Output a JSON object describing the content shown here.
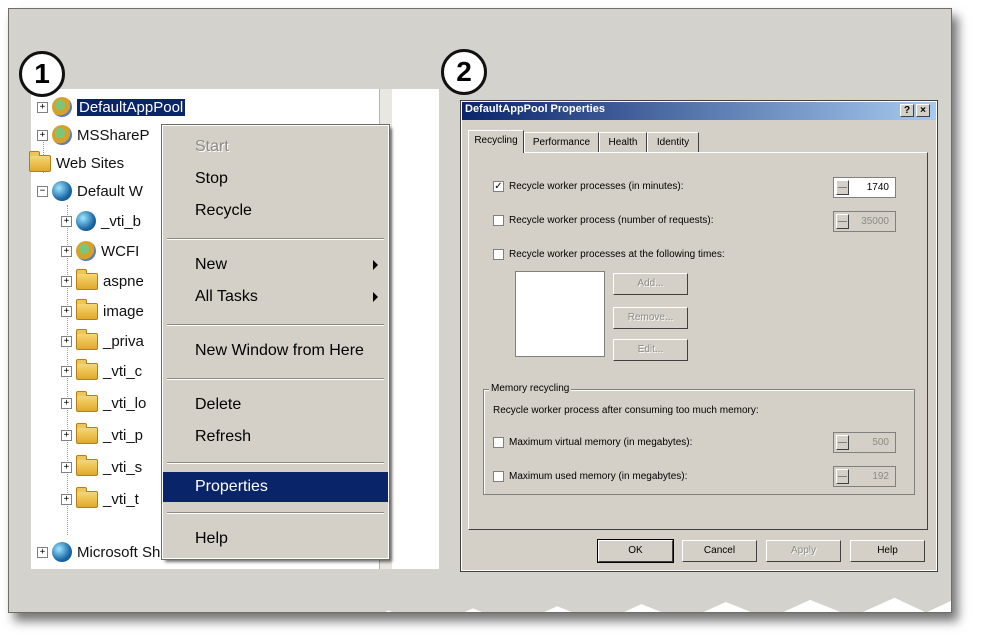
{
  "panel1": {
    "number": "1",
    "tree": [
      {
        "label": "DefaultAppPool",
        "icon": "app-pool-icon",
        "selected": true
      },
      {
        "label": "MSShareP",
        "icon": "app-pool-icon"
      },
      {
        "label": "Web Sites",
        "icon": "folder-icon"
      },
      {
        "label": "Default W",
        "icon": "globe-icon"
      },
      {
        "label": "_vti_b",
        "icon": "globe-icon"
      },
      {
        "label": "WCFI",
        "icon": "app-pool-icon"
      },
      {
        "label": "aspne",
        "icon": "folder-icon"
      },
      {
        "label": "image",
        "icon": "folder-icon"
      },
      {
        "label": "_priva",
        "icon": "folder-icon"
      },
      {
        "label": "_vti_c",
        "icon": "folder-icon"
      },
      {
        "label": "_vti_lo",
        "icon": "folder-icon"
      },
      {
        "label": "_vti_p",
        "icon": "folder-icon"
      },
      {
        "label": "_vti_s",
        "icon": "folder-icon"
      },
      {
        "label": "_vti_t",
        "icon": "folder-icon"
      },
      {
        "label": "Microsoft SharePoint Administration",
        "icon": "globe-icon"
      }
    ],
    "menu": {
      "start": "Start",
      "stop": "Stop",
      "recycle": "Recycle",
      "new": "New",
      "all_tasks": "All Tasks",
      "new_window": "New Window from Here",
      "delete": "Delete",
      "refresh": "Refresh",
      "properties": "Properties",
      "help": "Help"
    }
  },
  "panel2": {
    "number": "2",
    "title": "DefaultAppPool Properties",
    "help_btn": "?",
    "close_btn": "×",
    "tabs": [
      "Recycling",
      "Performance",
      "Health",
      "Identity"
    ],
    "active_tab": "Recycling",
    "recycle_minutes": {
      "label": "Recycle worker processes (in minutes):",
      "checked": true,
      "value": "1740"
    },
    "recycle_requests": {
      "label": "Recycle worker process (number of requests):",
      "checked": false,
      "value": "35000"
    },
    "recycle_times": {
      "label": "Recycle worker processes at the following times:",
      "checked": false
    },
    "add_btn": "Add...",
    "remove_btn": "Remove...",
    "edit_btn": "Edit...",
    "memory_group": "Memory recycling",
    "memory_desc": "Recycle worker process after consuming too much memory:",
    "max_virtual": {
      "label": "Maximum virtual memory (in megabytes):",
      "checked": false,
      "value": "500"
    },
    "max_used": {
      "label": "Maximum used memory (in megabytes):",
      "checked": false,
      "value": "192"
    },
    "ok": "OK",
    "cancel": "Cancel",
    "apply": "Apply",
    "help": "Help"
  }
}
